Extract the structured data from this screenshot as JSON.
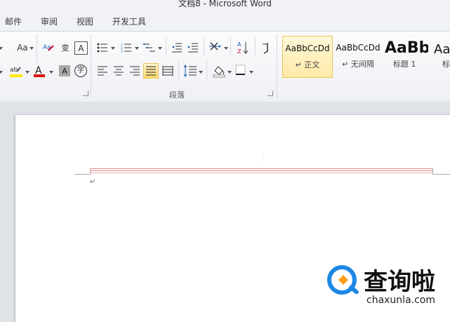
{
  "window": {
    "title": "文档8  -  Microsoft Word"
  },
  "tabs": [
    "邮件",
    "审阅",
    "视图",
    "开发工具"
  ],
  "ribbon": {
    "font": {
      "change_case_label": "Aa",
      "highlight_label": "ab",
      "font_color_label": "A",
      "char_shading_label": "A",
      "enclose_char_label": "字",
      "phonetic_label": "变",
      "border_label": "A"
    },
    "paragraph": {
      "group_label": "段落",
      "sort_label": "A↓Z",
      "show_marks_label": "↵"
    },
    "styles": [
      {
        "sample": "AaBbCcDd",
        "name": "↵ 正文",
        "active": true
      },
      {
        "sample": "AaBbCcDd",
        "name": "↵ 无间隔",
        "active": false
      },
      {
        "sample": "AaBb",
        "name": "标题 1",
        "active": false
      },
      {
        "sample": "Aa",
        "name": "标",
        "active": false
      }
    ]
  },
  "document": {
    "paragraph_mark": "↵"
  },
  "watermark": {
    "brand": "查询啦",
    "url": "chaxunla.com"
  },
  "colors": {
    "accent_highlight": "#e8c35c",
    "watermark_blue": "#1e88e5",
    "watermark_orange": "#ff9f1a"
  }
}
